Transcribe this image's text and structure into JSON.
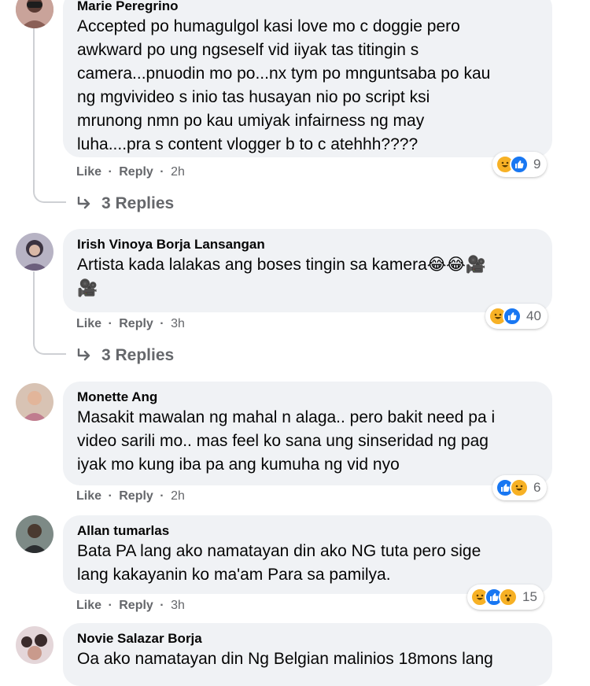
{
  "comments": [
    {
      "author": "Marie Peregrino",
      "text": "Accepted po humagulgol kasi love mo c doggie pero\nawkward po ung ngseself vid iiyak tas titingin s\ncamera...pnuodin mo po...nx tym po mnguntsaba po kau\nng mgvivideo s inio tas husayan nio po script ksi\nmrunong nmn po kau umiyak infairness ng may\nluha....pra s content vlogger b to c atehhh????",
      "like": "Like",
      "reply": "Reply",
      "time": "2h",
      "reactions": [
        "haha-icon",
        "like-icon"
      ],
      "reaction_count": "9",
      "replies": "3 Replies"
    },
    {
      "author": "Irish Vinoya Borja Lansangan",
      "text": "Artista kada lalakas ang boses tingin sa kamera😂😂🎥\n🎥",
      "like": "Like",
      "reply": "Reply",
      "time": "3h",
      "reactions": [
        "haha-icon",
        "like-icon"
      ],
      "reaction_count": "40",
      "replies": "3 Replies"
    },
    {
      "author": "Monette Ang",
      "text": "Masakit mawalan ng mahal n alaga.. pero bakit need pa i\nvideo sarili mo.. mas feel ko sana ung sinseridad ng pag\niyak mo kung iba pa ang kumuha ng vid nyo",
      "like": "Like",
      "reply": "Reply",
      "time": "2h",
      "reactions": [
        "like-icon",
        "haha-icon"
      ],
      "reaction_count": "6"
    },
    {
      "author": "Allan tumarlas",
      "text": "Bata PA lang ako namatayan din ako NG tuta pero sige\nlang kakayanin ko ma'am Para sa pamilya.",
      "like": "Like",
      "reply": "Reply",
      "time": "3h",
      "reactions": [
        "haha-icon",
        "like-icon",
        "wow-icon"
      ],
      "reaction_count": "15"
    },
    {
      "author": "Novie Salazar Borja",
      "text": "Oa ako namatayan din Ng Belgian malinios 18mons lang"
    }
  ],
  "separator": "·",
  "colors": {
    "bubble": "#f0f2f5",
    "meta": "#65676b",
    "like_blue": "#1877f2",
    "haha_yellow": "#f7b125"
  }
}
